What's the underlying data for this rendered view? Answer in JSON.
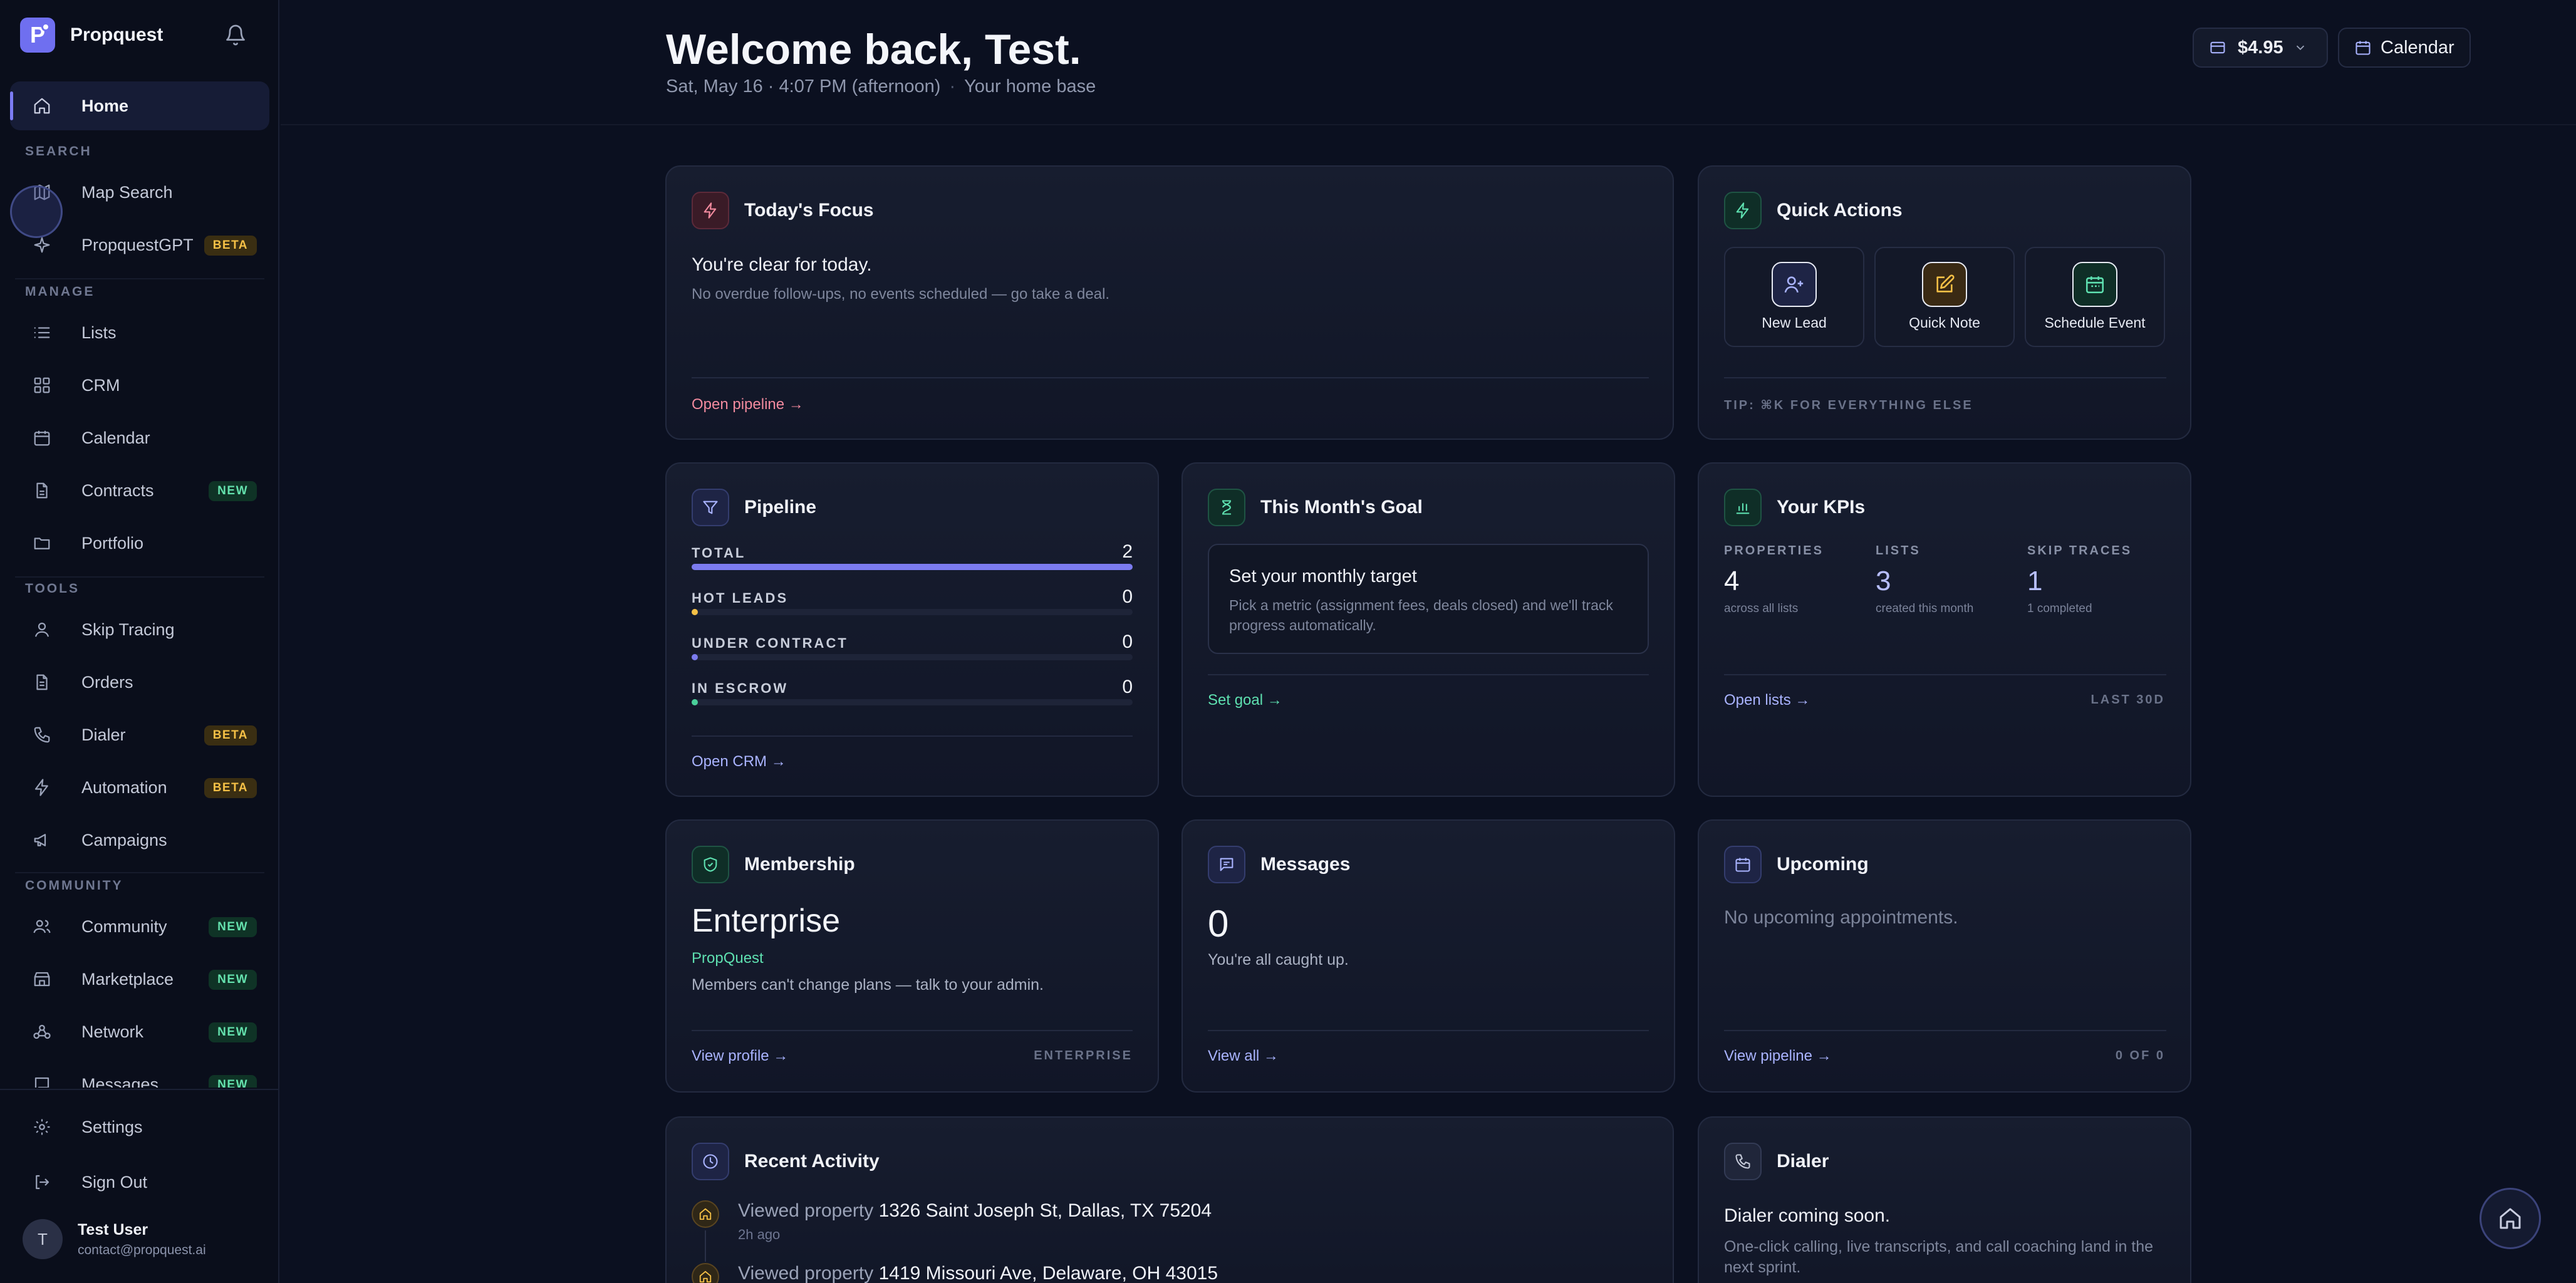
{
  "app": {
    "name": "Propquest"
  },
  "sidebar": {
    "home": "Home",
    "sections": {
      "search": "SEARCH",
      "manage": "MANAGE",
      "tools": "TOOLS",
      "community": "COMMUNITY"
    },
    "items": {
      "map_search": {
        "label": "Map Search"
      },
      "propquestgpt": {
        "label": "PropquestGPT",
        "badge": "BETA"
      },
      "lists": {
        "label": "Lists"
      },
      "crm": {
        "label": "CRM"
      },
      "calendar": {
        "label": "Calendar"
      },
      "contracts": {
        "label": "Contracts",
        "badge": "NEW"
      },
      "portfolio": {
        "label": "Portfolio"
      },
      "skip_tracing": {
        "label": "Skip Tracing"
      },
      "orders": {
        "label": "Orders"
      },
      "dialer": {
        "label": "Dialer",
        "badge": "BETA"
      },
      "automation": {
        "label": "Automation",
        "badge": "BETA"
      },
      "campaigns": {
        "label": "Campaigns"
      },
      "community": {
        "label": "Community",
        "badge": "NEW"
      },
      "marketplace": {
        "label": "Marketplace",
        "badge": "NEW"
      },
      "network": {
        "label": "Network",
        "badge": "NEW"
      },
      "messages": {
        "label": "Messages",
        "badge": "NEW"
      }
    },
    "footer": {
      "settings": "Settings",
      "sign_out": "Sign Out",
      "user_initial": "T",
      "user_name": "Test User",
      "user_email": "contact@propquest.ai"
    }
  },
  "header": {
    "welcome": "Welcome back, Test.",
    "date": "Sat, May 16 · 4:07 PM (afternoon)",
    "separator": "·",
    "tagline": "Your home base",
    "credits": "$4.95",
    "calendar": "Calendar"
  },
  "focus": {
    "title": "Today's Focus",
    "headline": "You're clear for today.",
    "sub": "No overdue follow-ups, no events scheduled — go take a deal.",
    "link": "Open pipeline →"
  },
  "quick_actions": {
    "title": "Quick Actions",
    "new_lead": "New Lead",
    "quick_note": "Quick Note",
    "schedule_event": "Schedule Event",
    "tip": "TIP: ⌘K FOR EVERYTHING ELSE"
  },
  "pipeline": {
    "title": "Pipeline",
    "rows": [
      {
        "label": "TOTAL",
        "value": "2",
        "fill": 1.0,
        "color": "#7b7bef"
      },
      {
        "label": "HOT LEADS",
        "value": "0",
        "fill": 0.0,
        "color": "#f5c046"
      },
      {
        "label": "UNDER CONTRACT",
        "value": "0",
        "fill": 0.0,
        "color": "#7b7bef"
      },
      {
        "label": "IN ESCROW",
        "value": "0",
        "fill": 0.0,
        "color": "#4ad09a"
      }
    ],
    "link": "Open CRM →"
  },
  "goal": {
    "title": "This Month's Goal",
    "headline": "Set your monthly target",
    "desc": "Pick a metric (assignment fees, deals closed) and we'll track progress automatically.",
    "link": "Set goal →"
  },
  "kpis": {
    "title": "Your KPIs",
    "properties": {
      "label": "PROPERTIES",
      "value": "4",
      "note": "across all lists"
    },
    "lists": {
      "label": "LISTS",
      "value": "3",
      "note": "created this month"
    },
    "skip_traces": {
      "label": "SKIP TRACES",
      "value": "1",
      "note": "1 completed"
    },
    "link": "Open lists →",
    "range": "LAST 30D"
  },
  "membership": {
    "title": "Membership",
    "plan": "Enterprise",
    "org": "PropQuest",
    "note": "Members can't change plans — talk to your admin.",
    "link": "View profile →",
    "tag": "ENTERPRISE"
  },
  "messages": {
    "title": "Messages",
    "count": "0",
    "note": "You're all caught up.",
    "link": "View all →"
  },
  "upcoming": {
    "title": "Upcoming",
    "note": "No upcoming appointments.",
    "link": "View pipeline →",
    "count": "0 OF 0"
  },
  "activity": {
    "title": "Recent Activity",
    "items": [
      {
        "prefix": "Viewed property",
        "address": "1326 Saint Joseph St, Dallas, TX 75204",
        "time": "2h ago"
      },
      {
        "prefix": "Viewed property",
        "address": "1419 Missouri Ave, Delaware, OH 43015",
        "time": ""
      }
    ]
  },
  "dialer": {
    "title": "Dialer",
    "headline": "Dialer coming soon.",
    "desc": "One-click calling, live transcripts, and call coaching land in the next sprint."
  }
}
